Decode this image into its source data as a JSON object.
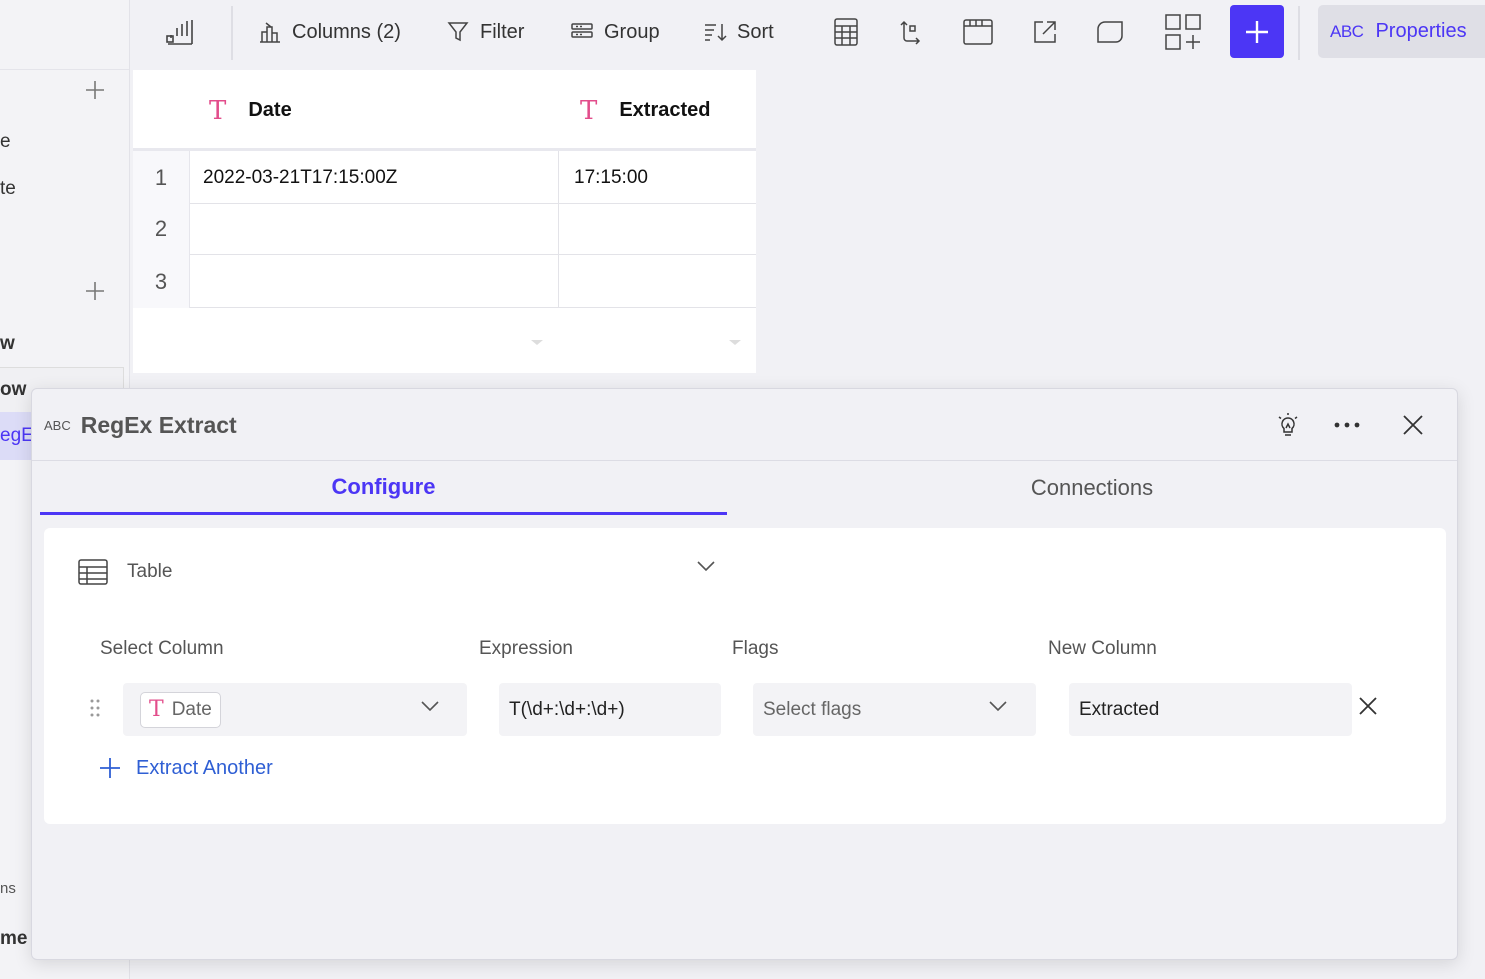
{
  "sidebar": {
    "fragments": [
      "e",
      "te",
      "w",
      "ow",
      "egEx",
      "ns",
      "me"
    ]
  },
  "toolbar": {
    "columns_label": "Columns (2)",
    "filter_label": "Filter",
    "group_label": "Group",
    "sort_label": "Sort",
    "properties_abc": "ABC",
    "properties_label": "Properties"
  },
  "grid": {
    "columns": [
      {
        "name": "Date",
        "type_icon": "T"
      },
      {
        "name": "Extracted",
        "type_icon": "T"
      }
    ],
    "rows": [
      {
        "num": "1",
        "date": "2022-03-21T17:15:00Z",
        "extracted": "17:15:00"
      },
      {
        "num": "2",
        "date": "",
        "extracted": ""
      },
      {
        "num": "3",
        "date": "",
        "extracted": ""
      }
    ]
  },
  "dialog": {
    "abc": "ABC",
    "title": "RegEx Extract",
    "tabs": [
      {
        "label": "Configure",
        "active": true
      },
      {
        "label": "Connections",
        "active": false
      }
    ],
    "source": "Table",
    "labels": {
      "select_column": "Select Column",
      "expression": "Expression",
      "flags": "Flags",
      "new_column": "New Column"
    },
    "row": {
      "column_type_icon": "T",
      "column": "Date",
      "expression": "T(\\d+:\\d+:\\d+)",
      "flags_placeholder": "Select flags",
      "new_column": "Extracted"
    },
    "add_label": "Extract Another"
  },
  "colors": {
    "accent": "#4c36f5",
    "type_icon": "#e24d8b",
    "link": "#2f5fd4"
  }
}
